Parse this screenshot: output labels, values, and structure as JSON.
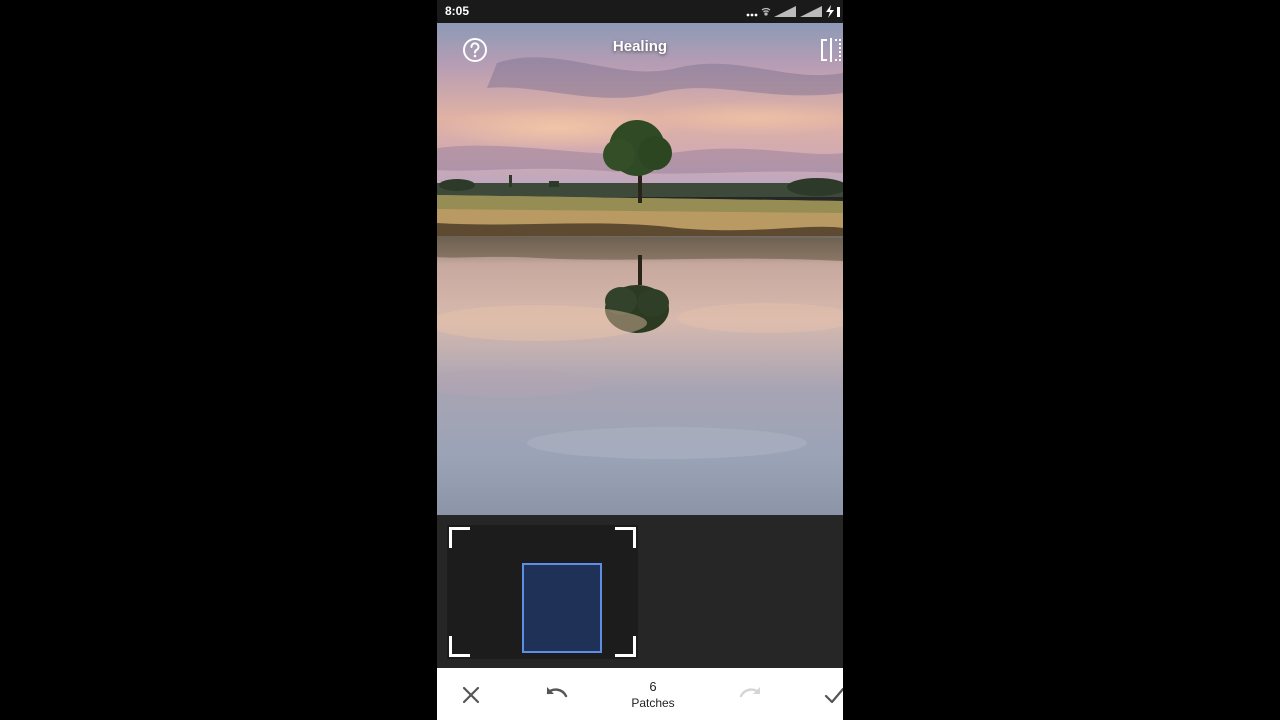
{
  "status_bar": {
    "time": "8:05",
    "icons": [
      "more-dots-icon",
      "wifi-icon",
      "signal-icon",
      "signal-icon",
      "charging-icon"
    ]
  },
  "editor": {
    "title": "Healing",
    "help_icon": "help-circle-icon",
    "compare_icon": "compare-split-icon"
  },
  "patches": {
    "count": "6",
    "label": "Patches"
  },
  "toolbar": {
    "cancel_icon": "close-icon",
    "undo_icon": "undo-icon",
    "redo_icon": "redo-icon",
    "apply_icon": "check-icon"
  },
  "colors": {
    "accent": "#5b8fe6",
    "panel": "#262626",
    "toolbar": "#ffffff"
  }
}
